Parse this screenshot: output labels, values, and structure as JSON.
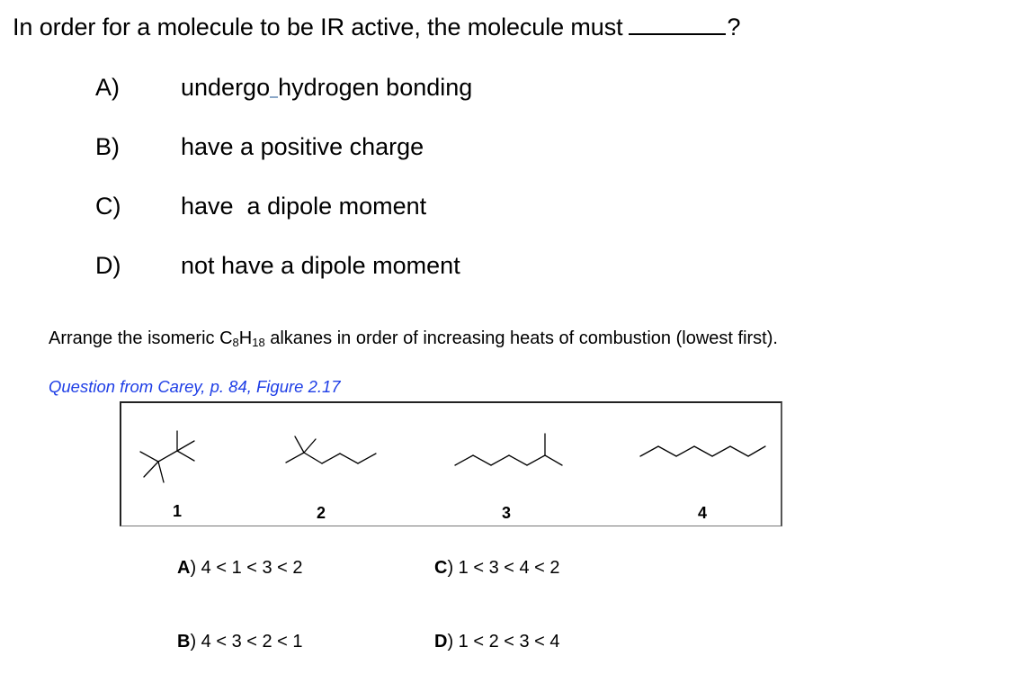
{
  "question1": {
    "stem": "In order for a molecule to be IR active, the molecule must",
    "stem_end": "?",
    "options": [
      {
        "letter": "A)",
        "text_before": "undergo",
        "text_after": "hydrogen bonding"
      },
      {
        "letter": "B)",
        "text": "have a positive charge"
      },
      {
        "letter": "C)",
        "text": "have  a dipole moment"
      },
      {
        "letter": "D)",
        "text": "not have a dipole moment"
      }
    ]
  },
  "question2": {
    "stem_before": "Arrange the isomeric C",
    "sub1": "8",
    "stem_mid": "H",
    "sub2": "18",
    "stem_after": " alkanes in order of increasing heats of combustion (lowest first).",
    "source": "Question from Carey, p. 84, Figure 2.17",
    "source_color": "#1e3ee6",
    "figure": {
      "molecules": [
        {
          "label": "1",
          "name": "2,2,3,3-tetramethylbutane"
        },
        {
          "label": "2",
          "name": "2,2-dimethylhexane"
        },
        {
          "label": "3",
          "name": "2-methylheptane"
        },
        {
          "label": "4",
          "name": "octane"
        }
      ]
    },
    "answers": [
      {
        "letter": "A",
        "text": ") 4 < 1 < 3 < 2"
      },
      {
        "letter": "B",
        "text": ") 4 < 3 < 2 < 1"
      },
      {
        "letter": "C",
        "text": ") 1 < 3 < 4 < 2"
      },
      {
        "letter": "D",
        "text": ") 1 < 2 < 3 < 4"
      }
    ]
  }
}
